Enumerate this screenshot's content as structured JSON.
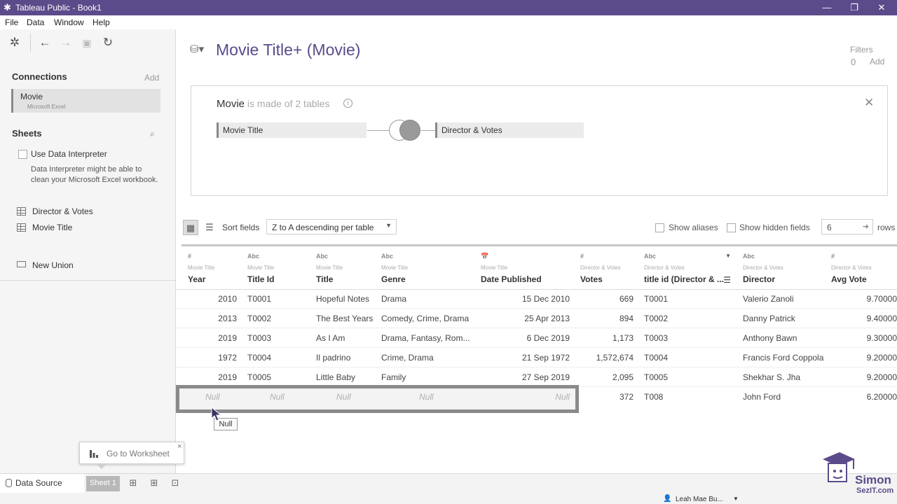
{
  "window": {
    "title": "Tableau Public - Book1",
    "minimize": "—",
    "restore": "❐",
    "close": "✕"
  },
  "menu": [
    "File",
    "Data",
    "Window",
    "Help"
  ],
  "left": {
    "connections_title": "Connections",
    "connections_add": "Add",
    "connection": {
      "name": "Movie",
      "type": "Microsoft Excel"
    },
    "sheets_title": "Sheets",
    "use_interpreter": "Use Data Interpreter",
    "interpreter_note": "Data Interpreter might be able to clean your Microsoft Excel workbook.",
    "sheets": [
      "Director & Votes",
      "Movie Title"
    ],
    "new_union": "New Union"
  },
  "header": {
    "datasource_title": "Movie Title+ (Movie)",
    "filters_label": "Filters",
    "filters_count": "0",
    "filters_add": "Add"
  },
  "canvas": {
    "ds_name": "Movie",
    "made_of": " is made of 2 tables",
    "info": "i",
    "tables": [
      "Movie Title",
      "Director & Votes"
    ]
  },
  "toolbar": {
    "sort_label": "Sort fields",
    "sort_value": "Z to A descending per table",
    "show_aliases": "Show aliases",
    "show_hidden": "Show hidden fields",
    "rows_value": "6",
    "rows_label": "rows"
  },
  "grid": {
    "columns": [
      {
        "type": "#",
        "source": "Movie Title",
        "name": "Year"
      },
      {
        "type": "Abc",
        "source": "Movie Title",
        "name": "Title Id"
      },
      {
        "type": "Abc",
        "source": "Movie Title",
        "name": "Title"
      },
      {
        "type": "Abc",
        "source": "Movie Title",
        "name": "Genre"
      },
      {
        "type": "📅",
        "source": "Movie Title",
        "name": "Date Published"
      },
      {
        "type": "#",
        "source": "Director & Votes",
        "name": "Votes"
      },
      {
        "type": "Abc",
        "source": "Director & Votes",
        "name": "title id (Director & ..."
      },
      {
        "type": "Abc",
        "source": "Director & Votes",
        "name": "Director"
      },
      {
        "type": "#",
        "source": "Director & Votes",
        "name": "Avg Vote"
      }
    ],
    "rows": [
      [
        "2010",
        "T0001",
        "Hopeful Notes",
        "Drama",
        "15 Dec 2010",
        "669",
        "T0001",
        "Valerio Zanoli",
        "9.70000"
      ],
      [
        "2013",
        "T0002",
        "The Best Years",
        "Comedy, Crime, Drama",
        "25 Apr 2013",
        "894",
        "T0002",
        "Danny Patrick",
        "9.40000"
      ],
      [
        "2019",
        "T0003",
        "As I Am",
        "Drama, Fantasy, Rom...",
        "6 Dec 2019",
        "1,173",
        "T0003",
        "Anthony Bawn",
        "9.30000"
      ],
      [
        "1972",
        "T0004",
        "Il padrino",
        "Crime, Drama",
        "21 Sep 1972",
        "1,572,674",
        "T0004",
        "Francis Ford Coppola",
        "9.20000"
      ],
      [
        "2019",
        "T0005",
        "Little Baby",
        "Family",
        "27 Sep 2019",
        "2,095",
        "T0005",
        "Shekhar S. Jha",
        "9.20000"
      ],
      [
        "Null",
        "Null",
        "Null",
        "Null",
        "Null",
        "372",
        "T008",
        "John Ford",
        "6.20000"
      ]
    ],
    "tooltip": "Null"
  },
  "goto": {
    "label": "Go to Worksheet",
    "close": "×"
  },
  "bottom": {
    "datasource_tab": "Data Source",
    "sheet_tab": "Sheet 1"
  },
  "status": {
    "user": "Leah Mae Bu..."
  },
  "watermark": {
    "line1": "Simon",
    "line2": "SezIT.com"
  },
  "colors": {
    "brand": "#5b4b8a",
    "highlight_border": "#8a8a8a"
  }
}
